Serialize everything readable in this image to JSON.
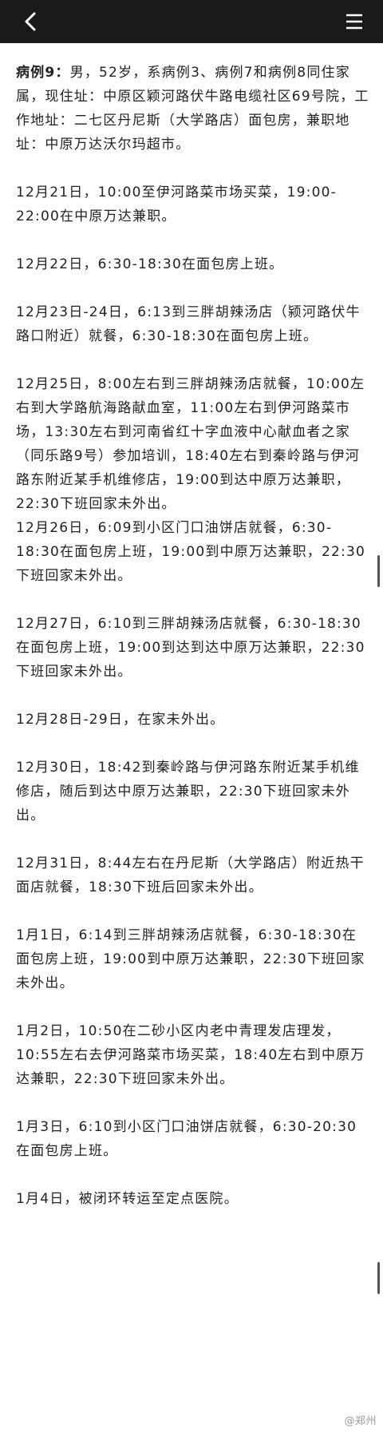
{
  "header": {
    "back_icon": "chevron-left-icon",
    "menu_icon": "hamburger-menu-icon",
    "background": "#1a1a1a"
  },
  "article": {
    "case_label": "病例9：",
    "case_intro": "男，52岁，系病例3、病例7和病例8同住家属，现住址：中原区颖河路伏牛路电缆社区69号院，工作地址：二七区丹尼斯（大学路店）面包房，兼职地址：中原万达沃尔玛超市。",
    "entries": [
      "12月21日，10:00至伊河路菜市场买菜，19:00-22:00在中原万达兼职。",
      "12月22日，6:30-18:30在面包房上班。",
      "12月23日-24日，6:13到三胖胡辣汤店（颍河路伏牛路口附近）就餐，6:30-18:30在面包房上班。",
      "12月25日，8:00左右到三胖胡辣汤店就餐，10:00左右到大学路航海路献血室，11:00左右到伊河路菜市场，13:30左右到河南省红十字血液中心献血者之家（同乐路9号）参加培训，18:40左右到秦岭路与伊河路东附近某手机维修店，19:00到达中原万达兼职，22:30下班回家未外出。",
      "12月26日，6:09到小区门口油饼店就餐，6:30-18:30在面包房上班，19:00到中原万达兼职，22:30下班回家未外出。",
      "12月27日，6:10到三胖胡辣汤店就餐，6:30-18:30在面包房上班，19:00到达到达中原万达兼职，22:30下班回家未外出。",
      "12月28日-29日，在家未外出。",
      "12月30日，18:42到秦岭路与伊河路东附近某手机维修店，随后到达中原万达兼职，22:30下班回家未外出。",
      "12月31日，8:44左右在丹尼斯（大学路店）附近热干面店就餐，18:30下班后回家未外出。",
      "1月1日，6:14到三胖胡辣汤店就餐，6:30-18:30在面包房上班，19:00到中原万达兼职，22:30下班回家未外出。",
      "1月2日，10:50在二砂小区内老中青理发店理发，10:55左右去伊河路菜市场买菜，18:40左右到中原万达兼职，22:30下班回家未外出。",
      "1月3日，6:10到小区门口油饼店就餐，6:30-20:30在面包房上班。",
      "1月4日，被闭环转运至定点医院。"
    ]
  },
  "watermark": "@郑州"
}
